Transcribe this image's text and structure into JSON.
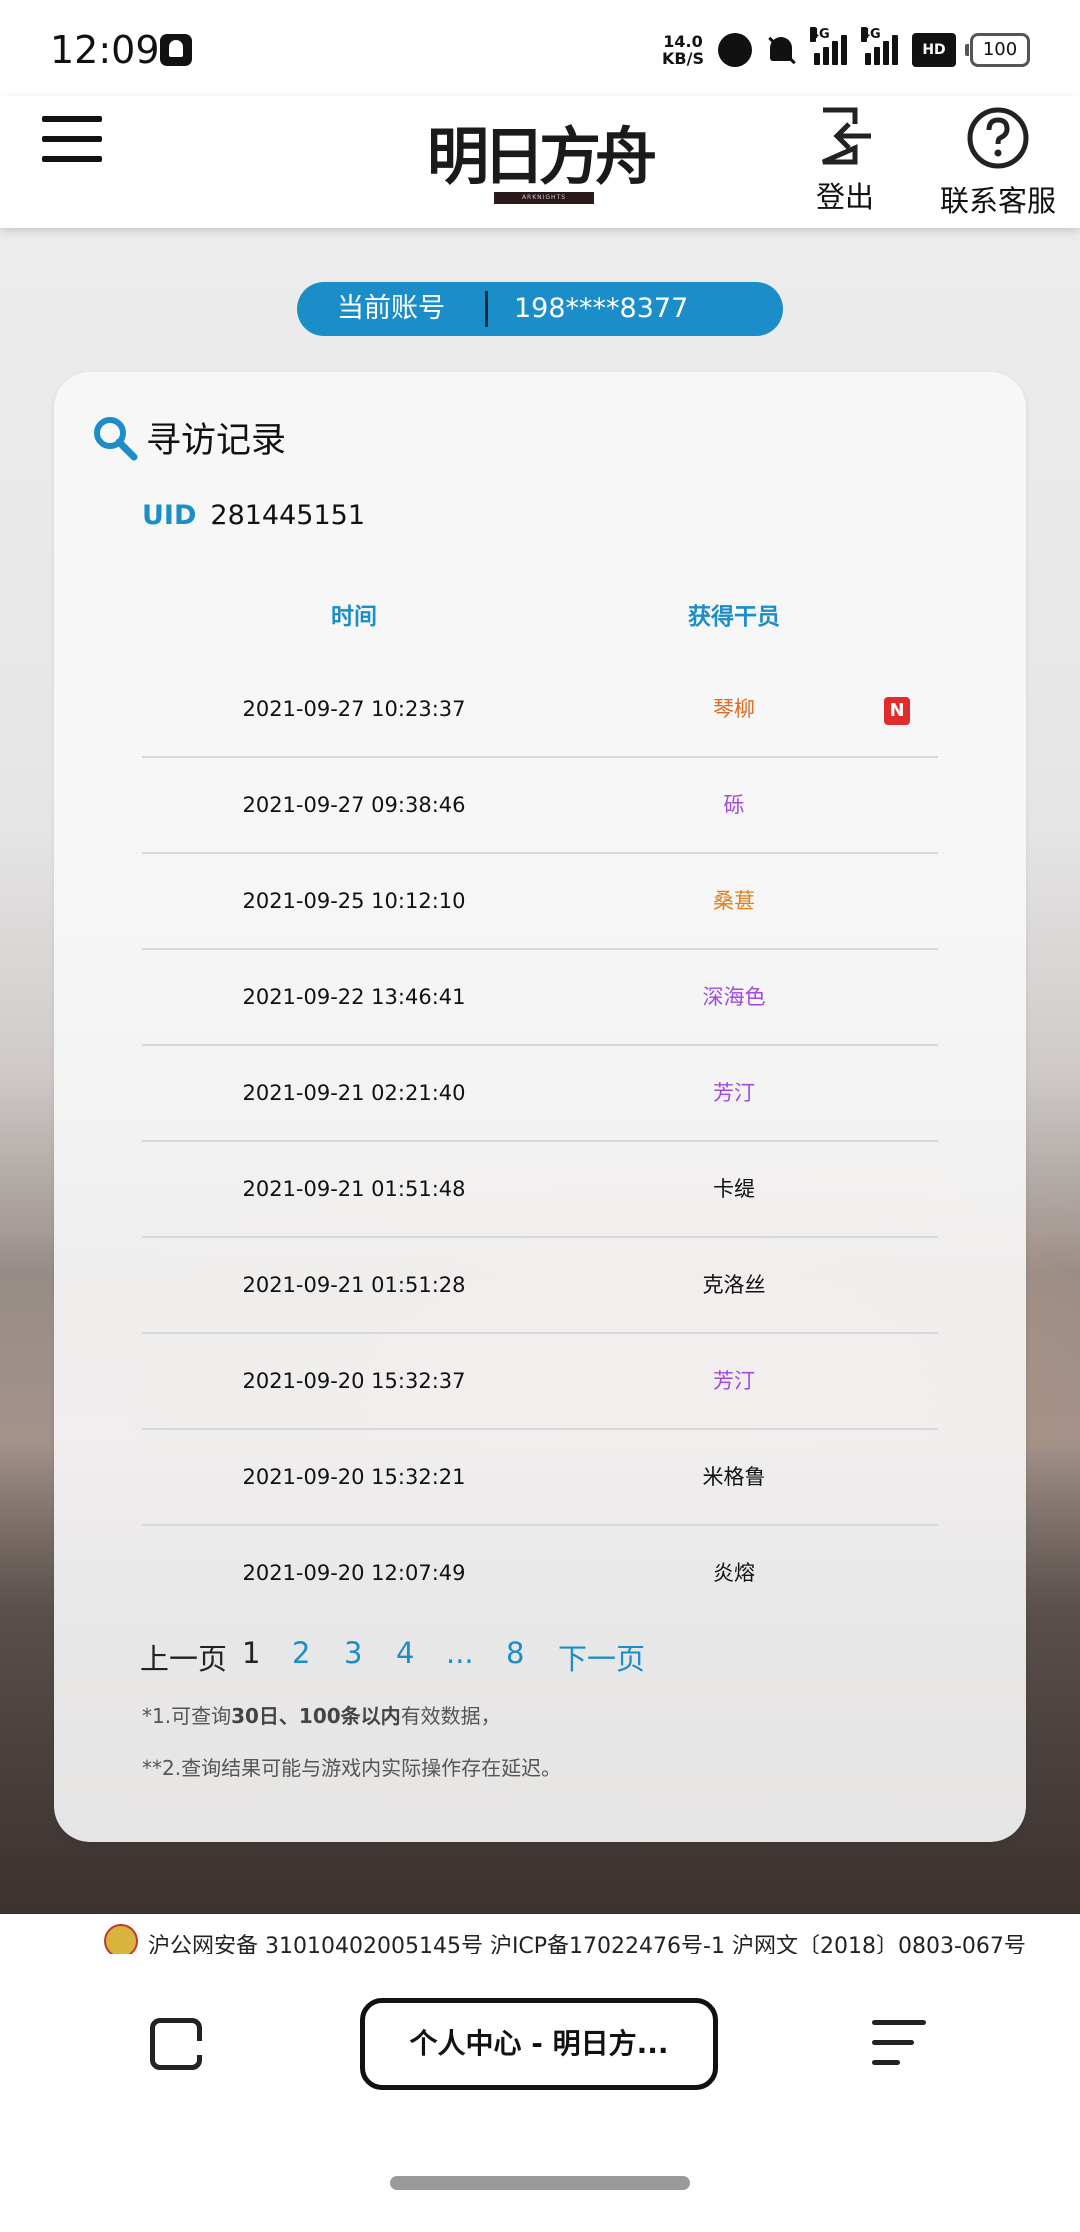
{
  "status_bar": {
    "time": "12:09",
    "net_speed": "14.0",
    "net_unit": "KB/S",
    "signal_1": "4G",
    "signal_2": "4G",
    "hd": "HD",
    "battery": "100"
  },
  "header": {
    "logo_text": "明日方舟",
    "logo_sub": "ARKNIGHTS",
    "logout_label": "登出",
    "support_label": "联系客服"
  },
  "account": {
    "label": "当前账号",
    "value": "198****8377"
  },
  "record": {
    "title": "寻访记录",
    "uid_label": "UID",
    "uid_value": "281445151",
    "col_time": "时间",
    "col_operator": "获得干员",
    "rows": [
      {
        "time": "2021-09-27 10:23:37",
        "operator": "琴柳",
        "color": "#e06b1f",
        "new": "N"
      },
      {
        "time": "2021-09-27 09:38:46",
        "operator": "砾",
        "color": "#a04be0"
      },
      {
        "time": "2021-09-25 10:12:10",
        "operator": "桑葚",
        "color": "#e0801f"
      },
      {
        "time": "2021-09-22 13:46:41",
        "operator": "深海色",
        "color": "#a04be0"
      },
      {
        "time": "2021-09-21 02:21:40",
        "operator": "芳汀",
        "color": "#a04be0"
      },
      {
        "time": "2021-09-21 01:51:48",
        "operator": "卡缇",
        "color": "#111111"
      },
      {
        "time": "2021-09-21 01:51:28",
        "operator": "克洛丝",
        "color": "#111111"
      },
      {
        "time": "2021-09-20 15:32:37",
        "operator": "芳汀",
        "color": "#a04be0"
      },
      {
        "time": "2021-09-20 15:32:21",
        "operator": "米格鲁",
        "color": "#111111"
      },
      {
        "time": "2021-09-20 12:07:49",
        "operator": "炎熔",
        "color": "#111111"
      }
    ],
    "pager": {
      "prev": "上一页",
      "pages": [
        "1",
        "2",
        "3",
        "4"
      ],
      "ellipsis": "...",
      "last": "8",
      "next": "下一页",
      "current": "1"
    },
    "note1": {
      "prefix": "*1.可查询",
      "bold": "30日、100条以内",
      "suffix": "有效数据，"
    },
    "note2": "**2.查询结果可能与游戏内实际操作存在延迟。"
  },
  "footer": {
    "text": "沪公网安备 31010402005145号 沪ICP备17022476号-1 沪网文〔2018〕0803-067号"
  },
  "browser": {
    "tab_title": "个人中心 - 明日方..."
  },
  "colors": {
    "accent": "#1b8dc8",
    "new_badge": "#e22c2c"
  }
}
